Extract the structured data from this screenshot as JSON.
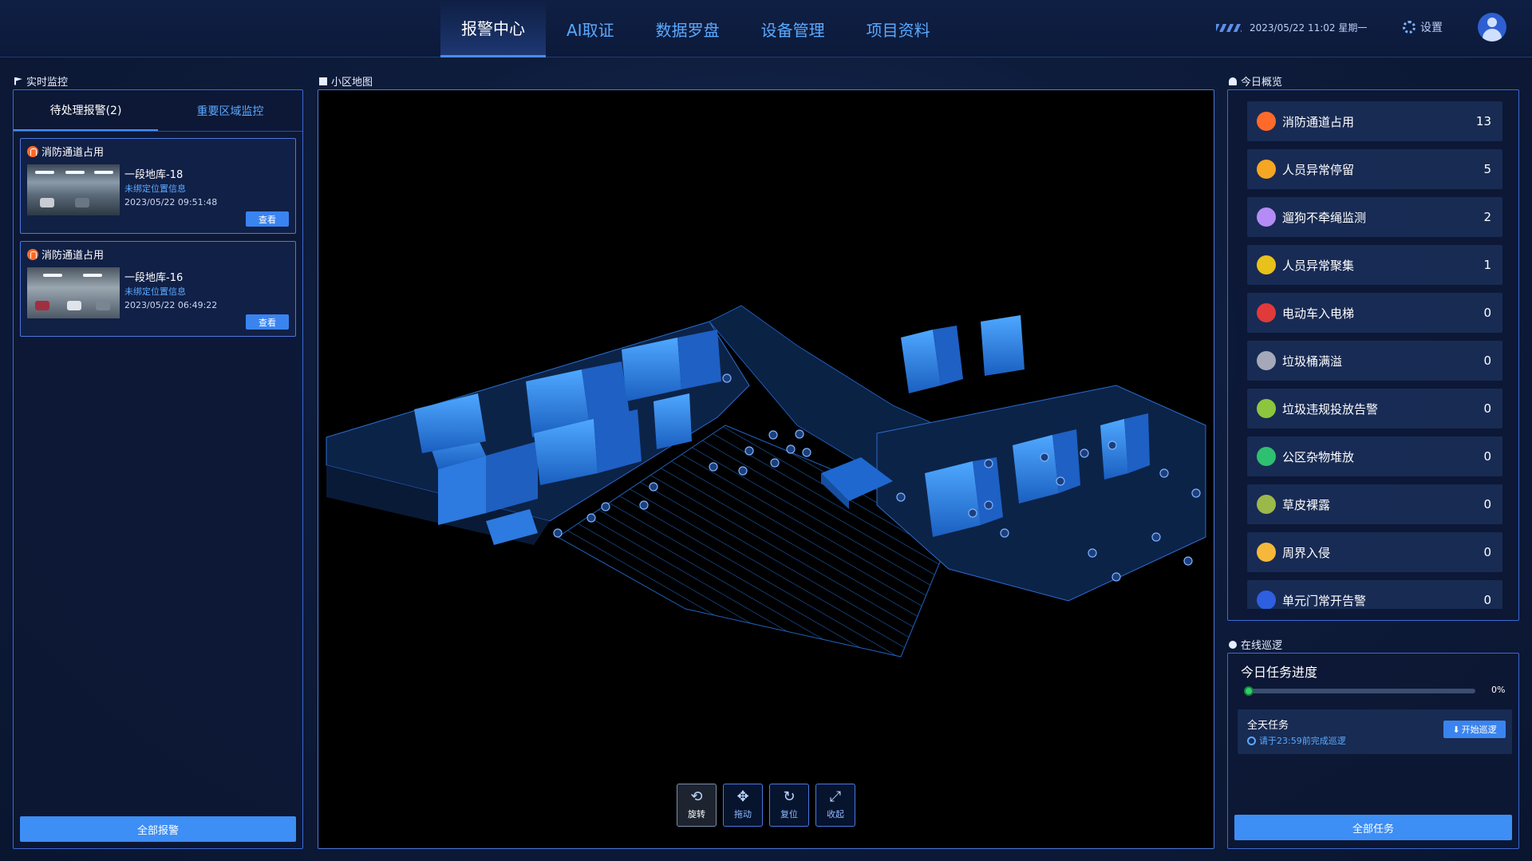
{
  "nav": {
    "items": [
      "报警中心",
      "AI取证",
      "数据罗盘",
      "设备管理",
      "项目资料"
    ],
    "active_index": 0
  },
  "header": {
    "datetime": "2023/05/22 11:02 星期一",
    "settings_label": "设置"
  },
  "left": {
    "section_title": "实时监控",
    "tabs": [
      "待处理报警(2)",
      "重要区域监控"
    ],
    "alarms": [
      {
        "type": "消防通道占用",
        "location": "一段地库-18",
        "position": "未绑定位置信息",
        "time": "2023/05/22 09:51:48",
        "button": "查看"
      },
      {
        "type": "消防通道占用",
        "location": "一段地库-16",
        "position": "未绑定位置信息",
        "time": "2023/05/22 06:49:22",
        "button": "查看"
      }
    ],
    "all_button": "全部报警"
  },
  "map": {
    "section_title": "小区地图",
    "tools": [
      {
        "label": "旋转",
        "icon": "rotate-3d-icon",
        "active": true
      },
      {
        "label": "拖动",
        "icon": "move-arrows-icon",
        "active": false
      },
      {
        "label": "复位",
        "icon": "reset-icon",
        "active": false
      },
      {
        "label": "收起",
        "icon": "collapse-icon",
        "active": false
      }
    ]
  },
  "overview": {
    "section_title": "今日概览",
    "items": [
      {
        "label": "消防通道占用",
        "count": "13",
        "color": "#ff6a2a",
        "icon": "fire-lane-icon"
      },
      {
        "label": "人员异常停留",
        "count": "5",
        "color": "#f5a623",
        "icon": "person-stay-icon"
      },
      {
        "label": "遛狗不牵绳监测",
        "count": "2",
        "color": "#b58cf5",
        "icon": "dog-icon"
      },
      {
        "label": "人员异常聚集",
        "count": "1",
        "color": "#e8c21a",
        "icon": "crowd-icon"
      },
      {
        "label": "电动车入电梯",
        "count": "0",
        "color": "#e03a3a",
        "icon": "ebike-icon"
      },
      {
        "label": "垃圾桶满溢",
        "count": "0",
        "color": "#a4a8b8",
        "icon": "trash-icon"
      },
      {
        "label": "垃圾违规投放告警",
        "count": "0",
        "color": "#8cc63f",
        "icon": "trash-warning-icon"
      },
      {
        "label": "公区杂物堆放",
        "count": "0",
        "color": "#2fbf71",
        "icon": "clutter-icon"
      },
      {
        "label": "草皮裸露",
        "count": "0",
        "color": "#9bb84a",
        "icon": "grass-icon"
      },
      {
        "label": "周界入侵",
        "count": "0",
        "color": "#f5b83a",
        "icon": "perimeter-icon"
      },
      {
        "label": "单元门常开告警",
        "count": "0",
        "color": "#2d5fe0",
        "icon": "door-icon"
      }
    ]
  },
  "patrol": {
    "section_title": "在线巡逻",
    "progress_title": "今日任务进度",
    "progress_percent": 0,
    "progress_label": "0%",
    "task_name": "全天任务",
    "task_deadline": "请于23:59前完成巡逻",
    "start_button": "开始巡逻",
    "all_button": "全部任务"
  }
}
